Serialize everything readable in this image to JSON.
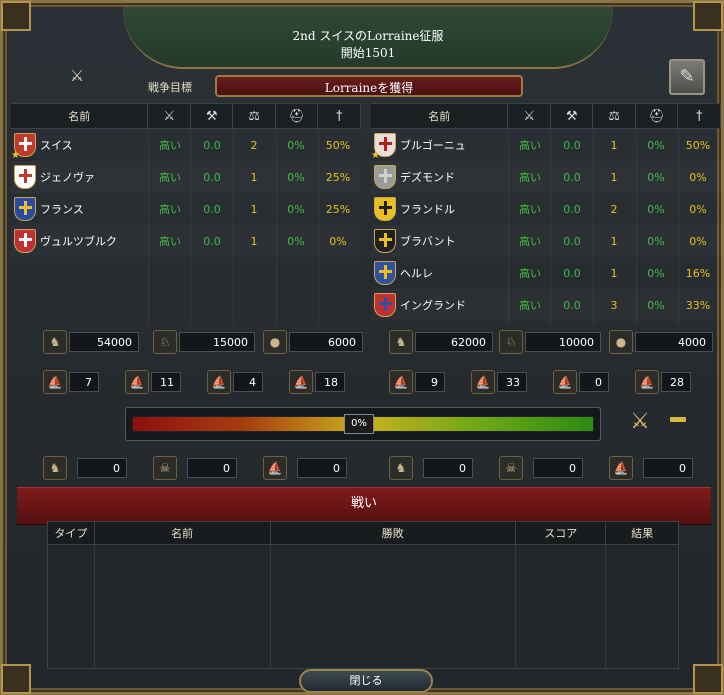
{
  "header": {
    "title": "2nd スイスのLorraine征服",
    "start": "開始1501"
  },
  "wargoal": {
    "label": "戦争目標",
    "value": "Lorraineを獲得"
  },
  "columns": {
    "name": "名前"
  },
  "icons": {
    "war_crossed": "crossed-swords-icon",
    "participation": "participation-icon",
    "war_score": "war-score-icon",
    "balance": "scales-icon",
    "morale": "helmet-icon",
    "attrition": "fencer-icon",
    "peace_sheet": "peace-document-icon"
  },
  "attackers": [
    {
      "name": "スイス",
      "participation": "高い",
      "score": "0.0",
      "count": "2",
      "helm": "0%",
      "fencer": "50%",
      "flag_color": "#c0392b",
      "cross": "#ffffff",
      "leader": true
    },
    {
      "name": "ジェノヴァ",
      "participation": "高い",
      "score": "0.0",
      "count": "1",
      "helm": "0%",
      "fencer": "25%",
      "flag_color": "#ffffff",
      "cross": "#c0392b",
      "leader": false
    },
    {
      "name": "フランス",
      "participation": "高い",
      "score": "0.0",
      "count": "1",
      "helm": "0%",
      "fencer": "25%",
      "flag_color": "#2a4aa0",
      "cross": "#e8c030",
      "leader": false
    },
    {
      "name": "ヴュルツブルク",
      "participation": "高い",
      "score": "0.0",
      "count": "1",
      "helm": "0%",
      "fencer": "0%",
      "flag_color": "#c03030",
      "cross": "#ffffff",
      "leader": false
    }
  ],
  "defenders": [
    {
      "name": "ブルゴーニュ",
      "participation": "高い",
      "score": "0.0",
      "count": "1",
      "helm": "0%",
      "fencer": "50%",
      "flag_color": "#e8e0d8",
      "cross": "#b02020",
      "leader": true
    },
    {
      "name": "デズモンド",
      "participation": "高い",
      "score": "0.0",
      "count": "1",
      "helm": "0%",
      "fencer": "0%",
      "flag_color": "#9a9a9a",
      "cross": "#d0d0d0",
      "leader": false
    },
    {
      "name": "フランドル",
      "participation": "高い",
      "score": "0.0",
      "count": "2",
      "helm": "0%",
      "fencer": "0%",
      "flag_color": "#e8c020",
      "cross": "#202020",
      "leader": false
    },
    {
      "name": "ブラバント",
      "participation": "高い",
      "score": "0.0",
      "count": "1",
      "helm": "0%",
      "fencer": "0%",
      "flag_color": "#202020",
      "cross": "#e8c020",
      "leader": false
    },
    {
      "name": "ヘルレ",
      "participation": "高い",
      "score": "0.0",
      "count": "1",
      "helm": "0%",
      "fencer": "16%",
      "flag_color": "#3050a0",
      "cross": "#e8c020",
      "leader": false
    },
    {
      "name": "イングランド",
      "participation": "高い",
      "score": "0.0",
      "count": "3",
      "helm": "0%",
      "fencer": "33%",
      "flag_color": "#c03030",
      "cross": "#3050a0",
      "leader": false
    }
  ],
  "forces": {
    "left": {
      "infantry": "54000",
      "cavalry": "15000",
      "artillery": "6000",
      "heavy": "7",
      "light": "11",
      "galley": "4",
      "transport": "18"
    },
    "right": {
      "infantry": "62000",
      "cavalry": "10000",
      "artillery": "4000",
      "heavy": "9",
      "light": "33",
      "galley": "0",
      "transport": "28"
    }
  },
  "warscore": {
    "percent": 0,
    "label": "0%"
  },
  "losses": {
    "left": {
      "a": "0",
      "b": "0",
      "c": "0"
    },
    "right": {
      "a": "0",
      "b": "0",
      "c": "0"
    }
  },
  "battles": {
    "title": "戦い",
    "headers": [
      "タイプ",
      "名前",
      "勝敗",
      "スコア",
      "結果"
    ]
  },
  "close_label": "閉じる"
}
